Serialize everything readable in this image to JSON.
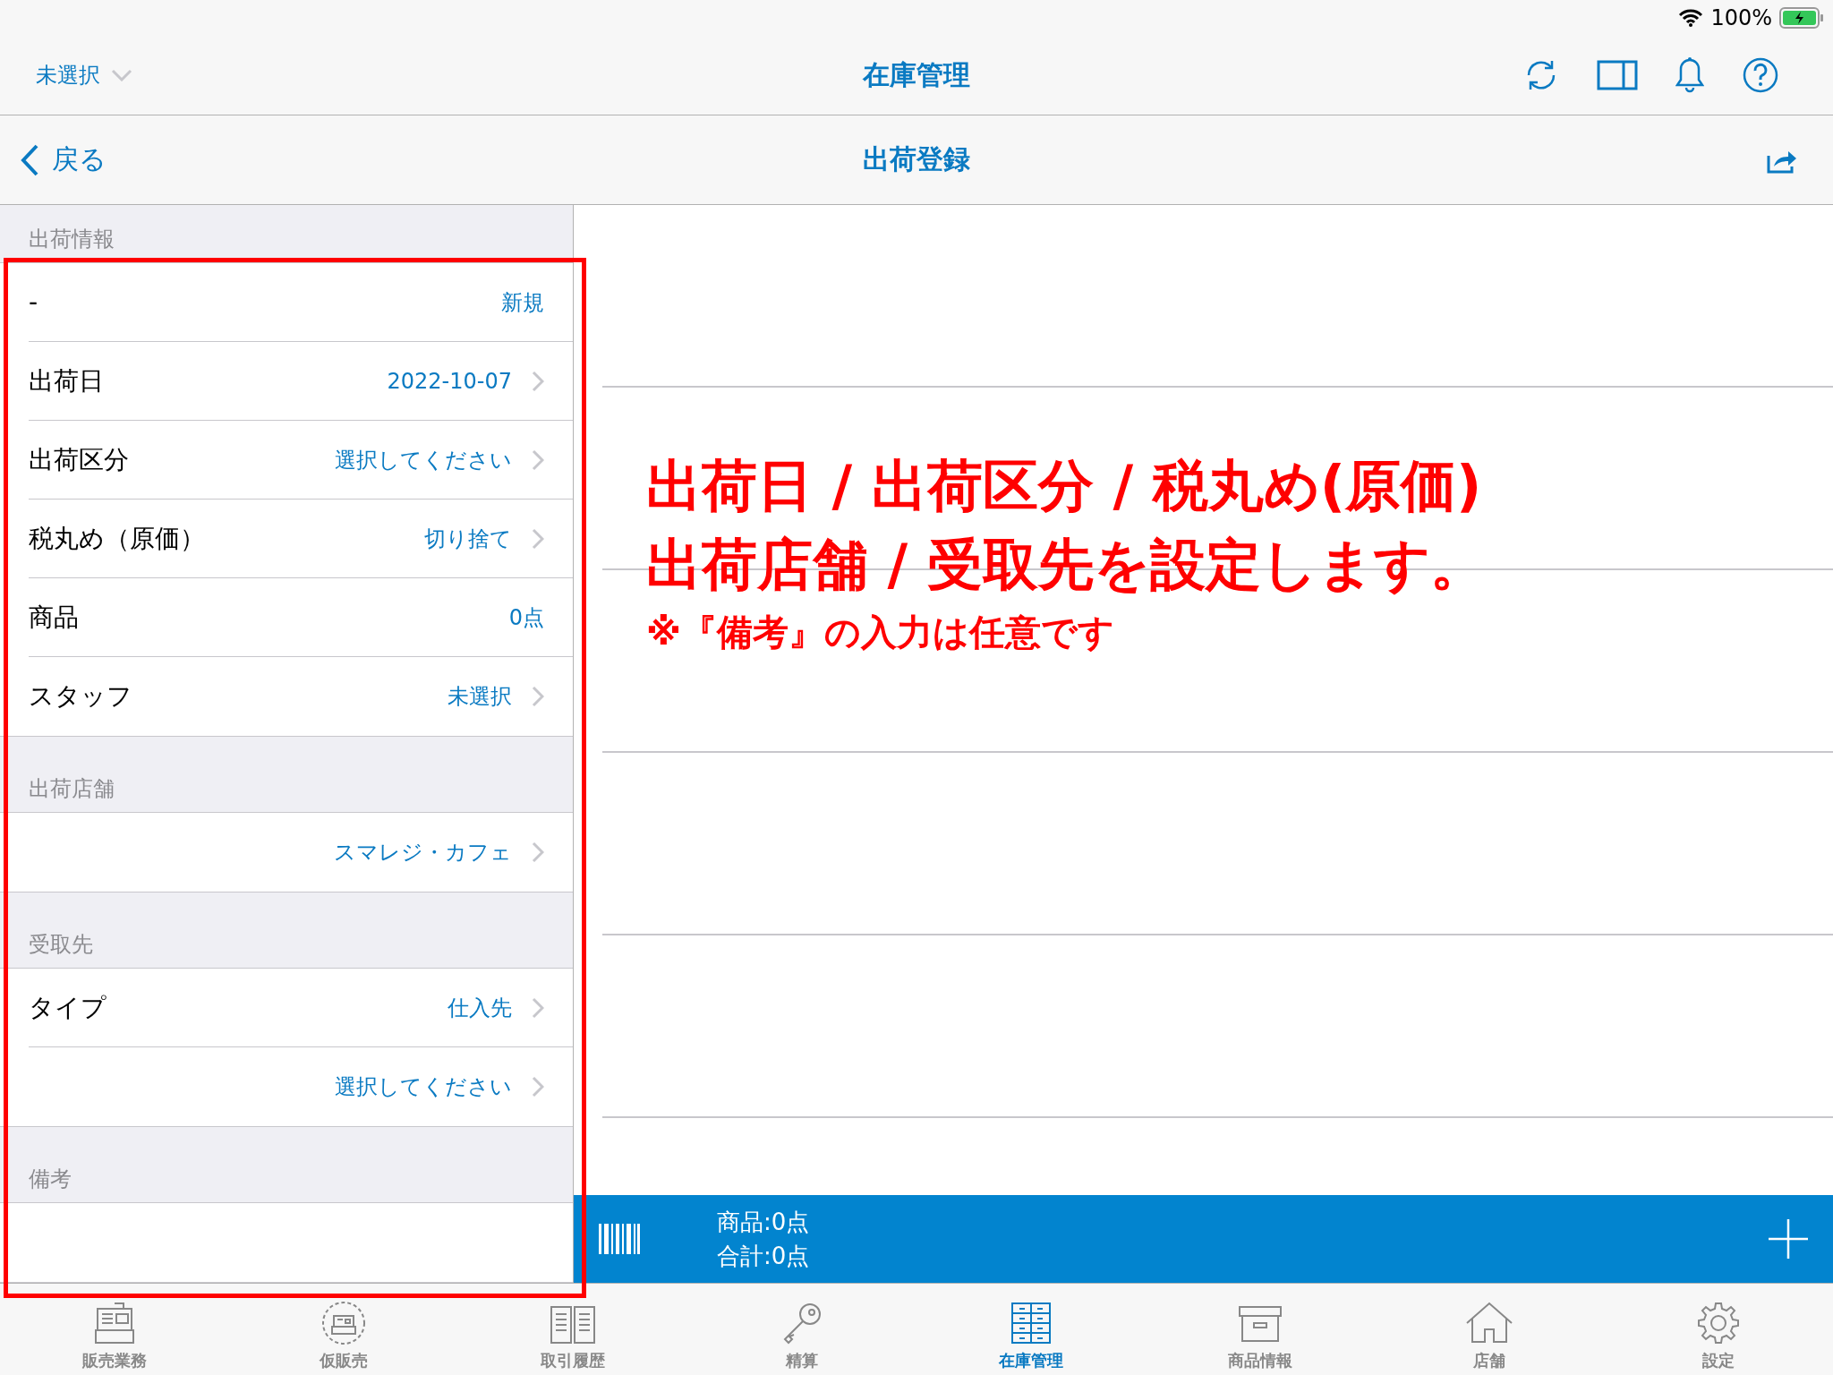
{
  "status_bar": {
    "battery": "100%"
  },
  "nav_bar": {
    "store_selector": "未選択",
    "title": "在庫管理"
  },
  "sub_bar": {
    "back": "戻る",
    "title": "出荷登録"
  },
  "sections": [
    {
      "header": "出荷情報",
      "rows": [
        {
          "label": "-",
          "value": "新規",
          "chevron": false
        },
        {
          "label": "出荷日",
          "value": "2022-10-07",
          "chevron": true
        },
        {
          "label": "出荷区分",
          "value": "選択してください",
          "chevron": true
        },
        {
          "label": "税丸め（原価）",
          "value": "切り捨て",
          "chevron": true
        },
        {
          "label": "商品",
          "value": "0点",
          "chevron": false
        },
        {
          "label": "スタッフ",
          "value": "未選択",
          "chevron": true
        }
      ]
    },
    {
      "header": "出荷店舗",
      "rows": [
        {
          "value": "スマレジ・カフェ",
          "chevron": true
        }
      ]
    },
    {
      "header": "受取先",
      "rows": [
        {
          "label": "タイプ",
          "value": "仕入先",
          "chevron": true
        },
        {
          "value": "選択してください",
          "chevron": true
        }
      ]
    },
    {
      "header": "備考",
      "rows": [
        {}
      ]
    }
  ],
  "annotation": {
    "lines": [
      "出荷日 / 出荷区分 / 税丸め(原価)",
      "出荷店舗 / 受取先を設定します。"
    ],
    "note": "※『備考』の入力は任意です"
  },
  "summary_bar": {
    "items": "商品:0点",
    "total": "合計:0点"
  },
  "tab_bar": [
    {
      "label": "販売業務",
      "selected": false
    },
    {
      "label": "仮販売",
      "selected": false
    },
    {
      "label": "取引履歴",
      "selected": false
    },
    {
      "label": "精算",
      "selected": false
    },
    {
      "label": "在庫管理",
      "selected": true
    },
    {
      "label": "商品情報",
      "selected": false
    },
    {
      "label": "店舗",
      "selected": false
    },
    {
      "label": "設定",
      "selected": false
    }
  ]
}
